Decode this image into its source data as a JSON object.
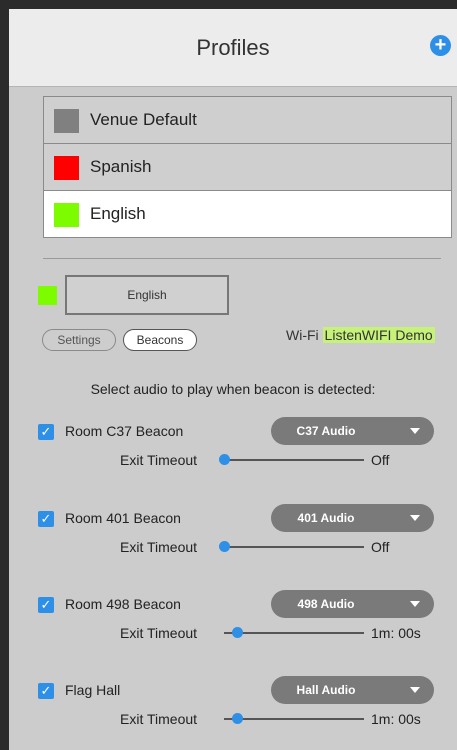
{
  "header": {
    "title": "Profiles",
    "add_icon": "plus-circle-icon"
  },
  "profiles": [
    {
      "label": "Venue Default",
      "color": "#808080",
      "selected": false
    },
    {
      "label": "Spanish",
      "color": "#ff0000",
      "selected": false
    },
    {
      "label": "English",
      "color": "#7dfc00",
      "selected": true
    }
  ],
  "current_profile": {
    "name": "English",
    "color": "#7dfc00"
  },
  "tabs": {
    "settings": "Settings",
    "beacons": "Beacons",
    "active": "Beacons"
  },
  "wifi": {
    "label": "Wi-Fi",
    "network": "ListenWIFI Demo"
  },
  "instruction": "Select audio to play when beacon is detected:",
  "beacons": [
    {
      "name": "Room C37 Beacon",
      "checked": true,
      "audio": "C37 Audio",
      "exit_label": "Exit Timeout",
      "timeout": "Off",
      "slider_position": 0
    },
    {
      "name": "Room 401 Beacon",
      "checked": true,
      "audio": "401 Audio",
      "exit_label": "Exit Timeout",
      "timeout": "Off",
      "slider_position": 0
    },
    {
      "name": "Room 498 Beacon",
      "checked": true,
      "audio": "498 Audio",
      "exit_label": "Exit Timeout",
      "timeout": "1m: 00s",
      "slider_position": 0.1
    },
    {
      "name": "Flag Hall",
      "checked": true,
      "audio": "Hall Audio",
      "exit_label": "Exit Timeout",
      "timeout": "1m: 00s",
      "slider_position": 0.1
    }
  ],
  "colors": {
    "accent": "#2d8fe6",
    "panel": "#cccccc",
    "header": "#ececec",
    "wifi_highlight": "#c6f27a"
  }
}
